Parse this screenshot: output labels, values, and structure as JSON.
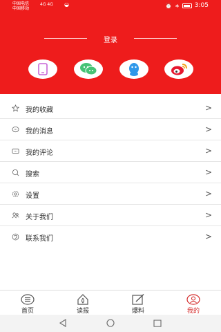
{
  "status_bar": {
    "carrier_1": "中国电信",
    "carrier_2": "中国移动",
    "signal_text": "4G 4G",
    "time": "3:05"
  },
  "header": {
    "login_label": "登录",
    "accent_color": "#ee1c1c"
  },
  "social_logins": [
    {
      "name": "phone-icon"
    },
    {
      "name": "wechat-icon"
    },
    {
      "name": "qq-icon"
    },
    {
      "name": "weibo-icon"
    }
  ],
  "menu": {
    "items": [
      {
        "label": "我的收藏",
        "icon": "star-icon"
      },
      {
        "label": "我的消息",
        "icon": "message-icon"
      },
      {
        "label": "我的评论",
        "icon": "comment-icon"
      },
      {
        "label": "搜索",
        "icon": "search-icon"
      },
      {
        "label": "设置",
        "icon": "settings-icon"
      },
      {
        "label": "关于我们",
        "icon": "about-icon"
      },
      {
        "label": "联系我们",
        "icon": "contact-icon"
      }
    ],
    "chevron": ">"
  },
  "tabs": [
    {
      "label": "首页",
      "icon": "home-menu-icon",
      "active": false
    },
    {
      "label": "读报",
      "icon": "newspaper-icon",
      "active": false
    },
    {
      "label": "爆料",
      "icon": "edit-icon",
      "active": false
    },
    {
      "label": "我的",
      "icon": "profile-icon",
      "active": true
    }
  ]
}
